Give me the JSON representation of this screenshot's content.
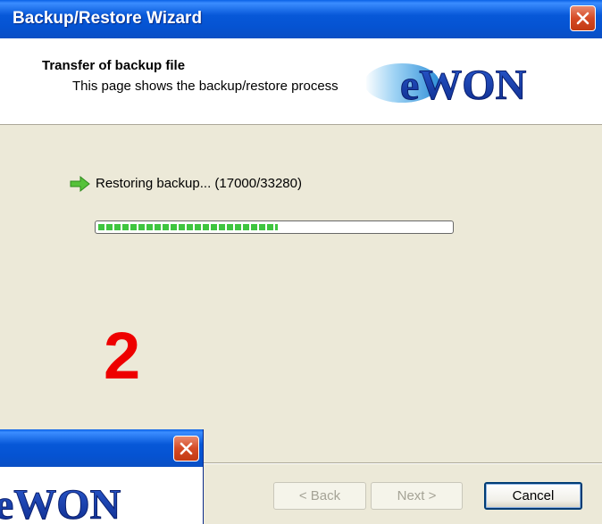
{
  "window": {
    "title": "Backup/Restore Wizard"
  },
  "header": {
    "title": "Transfer of backup file",
    "subtitle": "This page shows the backup/restore process",
    "logo_text": "eWON"
  },
  "status": {
    "icon": "green-arrow-icon",
    "text": "Restoring backup... (17000/33280)"
  },
  "progress": {
    "fraction": 0.51
  },
  "annotation": {
    "step_number": "2"
  },
  "buttons": {
    "back": "< Back",
    "next": "Next >",
    "cancel": "Cancel"
  },
  "overlay_window": {
    "logo_text": "eWON"
  },
  "colors": {
    "titlebar": "#0553d2",
    "progress": "#3fc53f",
    "annotation": "#ee0000",
    "logo": "#1a3fa8"
  }
}
